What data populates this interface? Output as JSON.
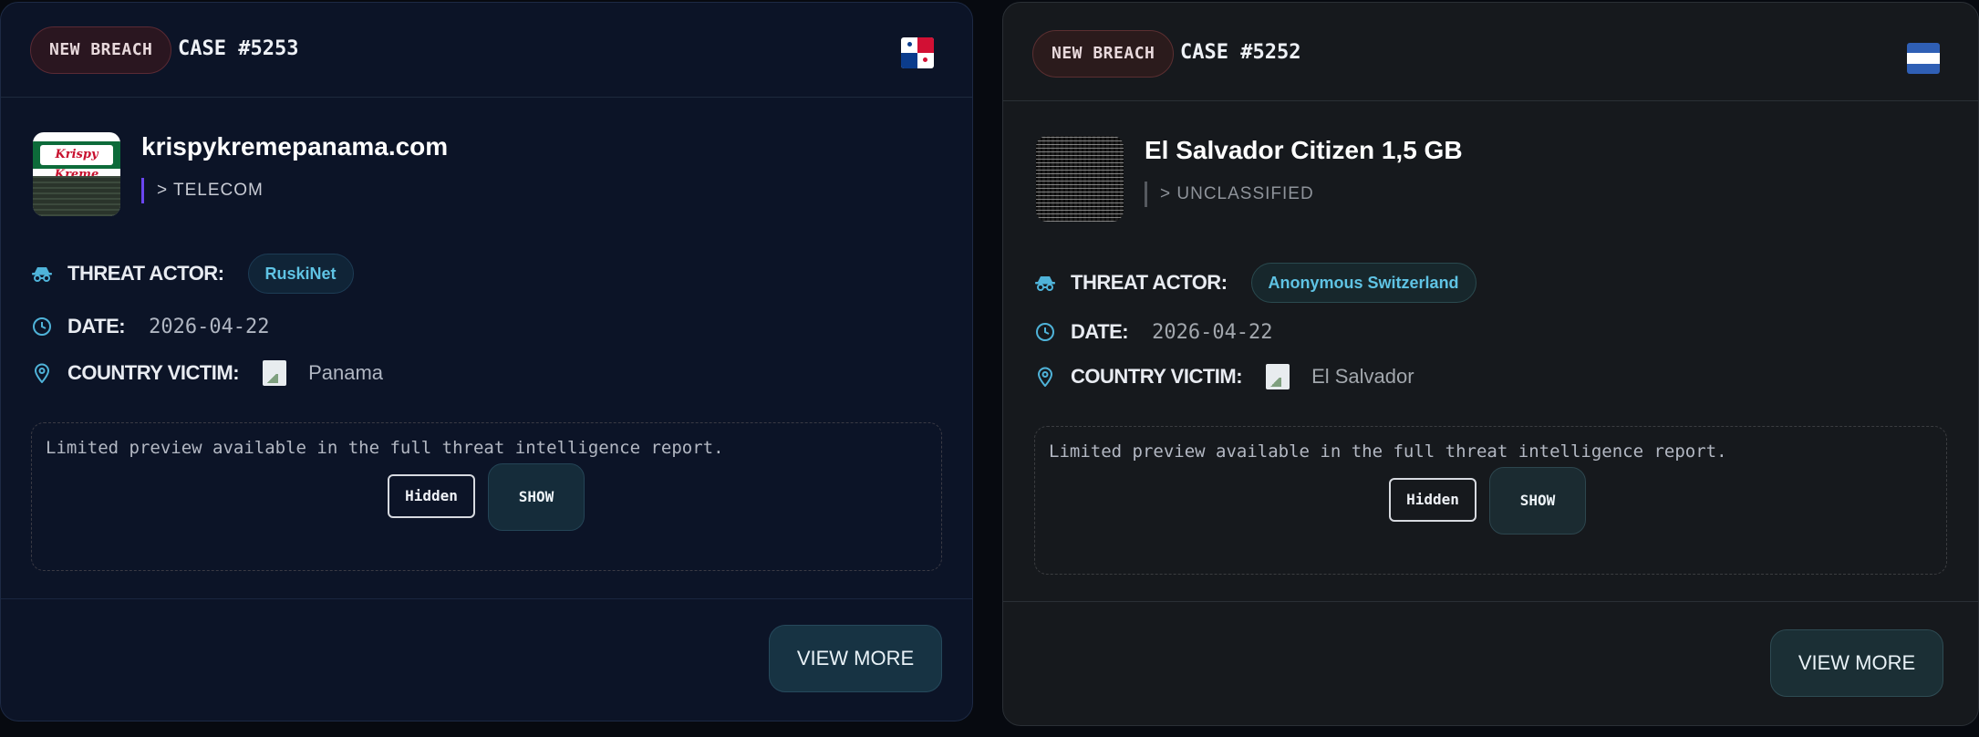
{
  "cards": [
    {
      "badge": "NEW BREACH",
      "case": "CASE #5253",
      "flag_icon": "panama-flag-icon",
      "title": "krispykremepanama.com",
      "sector": "> TELECOM",
      "threat_actor_label": "THREAT ACTOR:",
      "threat_actor": "RuskiNet",
      "date_label": "DATE:",
      "date": "2026-04-22",
      "country_label": "COUNTRY VICTIM:",
      "country": "Panama",
      "preview_text": "Limited preview available in the full threat intelligence report.",
      "hidden_label": "Hidden",
      "show_label": "SHOW",
      "view_more_label": "VIEW MORE",
      "thumbnail_logo": "Krispy Kreme"
    },
    {
      "badge": "NEW BREACH",
      "case": "CASE #5252",
      "flag_icon": "el-salvador-flag-icon",
      "title": "El Salvador Citizen 1,5 GB",
      "sector": "> UNCLASSIFIED",
      "threat_actor_label": "THREAT ACTOR:",
      "threat_actor": "Anonymous Switzerland",
      "date_label": "DATE:",
      "date": "2026-04-22",
      "country_label": "COUNTRY VICTIM:",
      "country": "El Salvador",
      "preview_text": "Limited preview available in the full threat intelligence report.",
      "hidden_label": "Hidden",
      "show_label": "SHOW",
      "view_more_label": "VIEW MORE"
    }
  ],
  "colors": {
    "accent": "#4fb3d9",
    "badge_bg": "#2a1620",
    "sector_bar_card1": "#6b46f0"
  }
}
